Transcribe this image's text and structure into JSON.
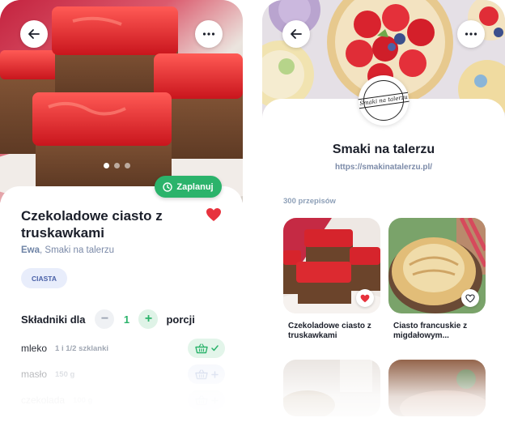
{
  "recipe": {
    "title": "Czekoladowe ciasto z truskawkami",
    "author_name": "Ewa",
    "author_source": "Smaki na talerzu",
    "tag": "CIASTA",
    "plan_label": "Zaplanuj",
    "favorited": true,
    "servings_label": "Składniki dla",
    "servings_value": "1",
    "servings_unit": "porcji",
    "minus_label": "−",
    "plus_label": "+",
    "photo_dots": {
      "count": 3,
      "active": 0
    },
    "ingredients": [
      {
        "name": "mleko",
        "qty": "1 i 1/2 szklanki",
        "in_basket": true
      },
      {
        "name": "masło",
        "qty": "150 g",
        "in_basket": false
      },
      {
        "name": "czekolada",
        "qty": "100 g",
        "in_basket": false
      }
    ],
    "icons": {
      "back": "arrow-left-icon",
      "more": "more-horizontal-icon",
      "heart": "heart-icon",
      "clock": "clock-icon",
      "basket": "basket-icon"
    }
  },
  "profile": {
    "name": "Smaki na talerzu",
    "logo_text": "Smaki na talerzu",
    "url": "https://smakinatalerzu.pl/",
    "count_label": "300 przepisów",
    "recipes": [
      {
        "title": "Czekoladowe ciasto z truskawkami",
        "favorited": true
      },
      {
        "title": "Ciasto francuskie z migdałowym...",
        "favorited": false
      }
    ]
  },
  "colors": {
    "accent_green": "#2bb36b",
    "heart_red": "#e7323d",
    "muted_blue": "#7b8aa8",
    "tag_bg": "#e8edfb"
  }
}
